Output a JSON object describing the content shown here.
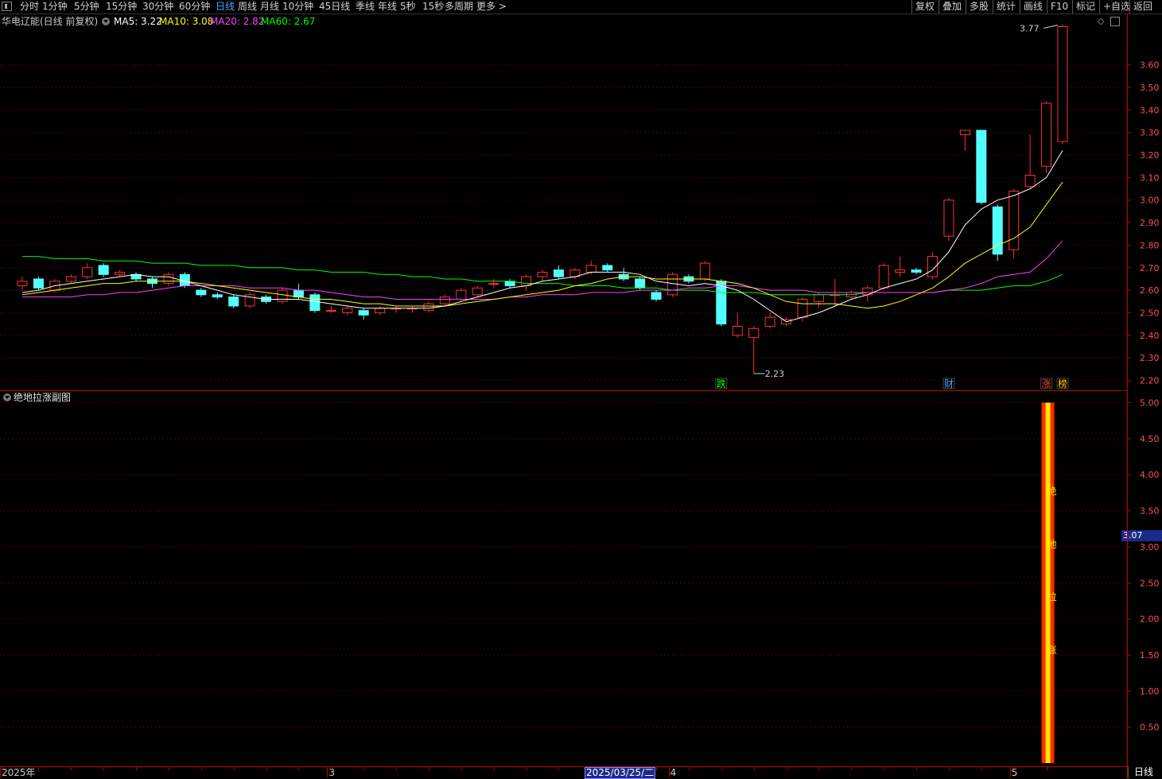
{
  "toolbar": {
    "periods": [
      "分时",
      "1分钟",
      "5分钟",
      "15分钟",
      "30分钟",
      "60分钟",
      "日线",
      "周线",
      "月线",
      "10分钟",
      "45日线",
      "季线",
      "年线",
      "5秒",
      "15秒",
      "多周期",
      "更多 >"
    ],
    "active_period": "日线",
    "right_buttons": [
      "复权",
      "叠加",
      "多股",
      "统计",
      "画线",
      "F10",
      "标记",
      "+自选",
      "返回"
    ]
  },
  "stock": {
    "title": "华电辽能(日线 前复权)",
    "ma_labels": [
      {
        "text": "MA5: 3.22",
        "color": "#ffffff"
      },
      {
        "text": "MA10: 3.08",
        "color": "#ffff00"
      },
      {
        "text": "MA20: 2.82",
        "color": "#ff40ff"
      },
      {
        "text": "MA60: 2.67",
        "color": "#00ff00"
      }
    ]
  },
  "colors": {
    "up": "#ff3030",
    "down": "#54ffff",
    "grid": "#8b0000",
    "axis": "#c00000",
    "ma5": "#ffffff",
    "ma10": "#ffff00",
    "ma20": "#ff40ff",
    "ma60": "#00ff00"
  },
  "chart_data": [
    {
      "type": "candlestick",
      "title": "华电辽能(日线 前复权)",
      "ylim": [
        2.17,
        3.8
      ],
      "y_ticks": [
        "3.60",
        "3.50",
        "3.40",
        "3.30",
        "3.20",
        "3.10",
        "3.00",
        "2.90",
        "2.80",
        "2.70",
        "2.60",
        "2.50",
        "2.40",
        "2.30",
        "2.20"
      ],
      "annotations": {
        "high": "3.77",
        "low": "2.23"
      },
      "markers": [
        {
          "text": "跌",
          "index": 43,
          "color": "#00ff00"
        },
        {
          "text": "财",
          "index": 57,
          "color": "#4aa3ff"
        },
        {
          "text": "涨",
          "index": 63,
          "color": "#ff4040"
        },
        {
          "text": "榜",
          "index": 64,
          "color": "#ffcc00"
        }
      ],
      "candles": [
        [
          2.62,
          2.64,
          2.66,
          2.6
        ],
        [
          2.65,
          2.61,
          2.66,
          2.6
        ],
        [
          2.6,
          2.64,
          2.65,
          2.59
        ],
        [
          2.64,
          2.66,
          2.67,
          2.63
        ],
        [
          2.66,
          2.7,
          2.72,
          2.65
        ],
        [
          2.71,
          2.67,
          2.72,
          2.66
        ],
        [
          2.67,
          2.68,
          2.69,
          2.66
        ],
        [
          2.67,
          2.65,
          2.68,
          2.64
        ],
        [
          2.65,
          2.63,
          2.66,
          2.61
        ],
        [
          2.63,
          2.67,
          2.68,
          2.62
        ],
        [
          2.67,
          2.62,
          2.68,
          2.61
        ],
        [
          2.6,
          2.58,
          2.61,
          2.57
        ],
        [
          2.58,
          2.57,
          2.59,
          2.56
        ],
        [
          2.57,
          2.53,
          2.58,
          2.52
        ],
        [
          2.53,
          2.58,
          2.59,
          2.52
        ],
        [
          2.57,
          2.55,
          2.58,
          2.54
        ],
        [
          2.55,
          2.6,
          2.61,
          2.54
        ],
        [
          2.6,
          2.57,
          2.63,
          2.56
        ],
        [
          2.58,
          2.51,
          2.59,
          2.5
        ],
        [
          2.51,
          2.51,
          2.53,
          2.5
        ],
        [
          2.5,
          2.52,
          2.53,
          2.49
        ],
        [
          2.51,
          2.49,
          2.52,
          2.47
        ],
        [
          2.5,
          2.52,
          2.53,
          2.49
        ],
        [
          2.52,
          2.52,
          2.53,
          2.5
        ],
        [
          2.52,
          2.52,
          2.53,
          2.5
        ],
        [
          2.51,
          2.54,
          2.55,
          2.5
        ],
        [
          2.54,
          2.57,
          2.58,
          2.53
        ],
        [
          2.56,
          2.6,
          2.61,
          2.55
        ],
        [
          2.58,
          2.61,
          2.62,
          2.57
        ],
        [
          2.63,
          2.63,
          2.65,
          2.61
        ],
        [
          2.64,
          2.62,
          2.65,
          2.61
        ],
        [
          2.62,
          2.66,
          2.67,
          2.6
        ],
        [
          2.66,
          2.68,
          2.69,
          2.64
        ],
        [
          2.69,
          2.66,
          2.71,
          2.65
        ],
        [
          2.66,
          2.69,
          2.7,
          2.65
        ],
        [
          2.68,
          2.71,
          2.73,
          2.67
        ],
        [
          2.71,
          2.69,
          2.72,
          2.68
        ],
        [
          2.67,
          2.65,
          2.7,
          2.64
        ],
        [
          2.65,
          2.61,
          2.66,
          2.6
        ],
        [
          2.59,
          2.56,
          2.6,
          2.55
        ],
        [
          2.58,
          2.67,
          2.68,
          2.57
        ],
        [
          2.66,
          2.64,
          2.67,
          2.63
        ],
        [
          2.65,
          2.72,
          2.73,
          2.64
        ],
        [
          2.64,
          2.45,
          2.65,
          2.44
        ],
        [
          2.4,
          2.44,
          2.5,
          2.39
        ],
        [
          2.39,
          2.43,
          2.44,
          2.23
        ],
        [
          2.44,
          2.48,
          2.5,
          2.43
        ],
        [
          2.45,
          2.47,
          2.48,
          2.44
        ],
        [
          2.48,
          2.56,
          2.57,
          2.46
        ],
        [
          2.55,
          2.58,
          2.59,
          2.52
        ],
        [
          2.58,
          2.58,
          2.65,
          2.53
        ],
        [
          2.57,
          2.59,
          2.6,
          2.56
        ],
        [
          2.58,
          2.61,
          2.62,
          2.55
        ],
        [
          2.61,
          2.71,
          2.72,
          2.6
        ],
        [
          2.68,
          2.69,
          2.75,
          2.66
        ],
        [
          2.69,
          2.68,
          2.7,
          2.67
        ],
        [
          2.66,
          2.75,
          2.77,
          2.65
        ],
        [
          2.84,
          3.0,
          3.01,
          2.82
        ],
        [
          3.29,
          3.31,
          3.31,
          3.22
        ],
        [
          3.31,
          2.99,
          3.31,
          2.98
        ],
        [
          2.97,
          2.76,
          2.98,
          2.73
        ],
        [
          2.78,
          3.04,
          3.05,
          2.74
        ],
        [
          3.06,
          3.11,
          3.29,
          3.05
        ],
        [
          3.15,
          3.43,
          3.44,
          3.12
        ],
        [
          3.26,
          3.77,
          3.78,
          3.25
        ]
      ],
      "ma5": [
        2.59,
        2.6,
        2.62,
        2.63,
        2.64,
        2.65,
        2.66,
        2.67,
        2.66,
        2.66,
        2.64,
        2.62,
        2.6,
        2.58,
        2.57,
        2.56,
        2.56,
        2.56,
        2.55,
        2.54,
        2.53,
        2.52,
        2.52,
        2.52,
        2.52,
        2.52,
        2.53,
        2.55,
        2.57,
        2.59,
        2.61,
        2.62,
        2.64,
        2.65,
        2.66,
        2.68,
        2.68,
        2.68,
        2.67,
        2.64,
        2.63,
        2.62,
        2.63,
        2.62,
        2.6,
        2.56,
        2.51,
        2.46,
        2.48,
        2.5,
        2.53,
        2.56,
        2.58,
        2.61,
        2.63,
        2.65,
        2.69,
        2.77,
        2.89,
        2.96,
        3.0,
        3.02,
        3.05,
        3.1,
        3.22
      ],
      "ma10": [
        2.58,
        2.59,
        2.6,
        2.61,
        2.62,
        2.63,
        2.63,
        2.64,
        2.64,
        2.64,
        2.64,
        2.63,
        2.62,
        2.61,
        2.6,
        2.59,
        2.58,
        2.57,
        2.56,
        2.56,
        2.55,
        2.54,
        2.54,
        2.53,
        2.53,
        2.53,
        2.53,
        2.54,
        2.55,
        2.56,
        2.57,
        2.58,
        2.59,
        2.6,
        2.62,
        2.63,
        2.65,
        2.66,
        2.66,
        2.65,
        2.65,
        2.65,
        2.65,
        2.64,
        2.63,
        2.61,
        2.58,
        2.55,
        2.54,
        2.54,
        2.54,
        2.53,
        2.52,
        2.53,
        2.55,
        2.58,
        2.61,
        2.66,
        2.72,
        2.76,
        2.8,
        2.83,
        2.88,
        2.98,
        3.08
      ],
      "ma20": [
        2.57,
        2.57,
        2.57,
        2.57,
        2.58,
        2.58,
        2.59,
        2.59,
        2.6,
        2.61,
        2.62,
        2.62,
        2.62,
        2.62,
        2.61,
        2.61,
        2.61,
        2.6,
        2.6,
        2.59,
        2.58,
        2.57,
        2.57,
        2.56,
        2.56,
        2.56,
        2.56,
        2.56,
        2.56,
        2.56,
        2.57,
        2.57,
        2.58,
        2.58,
        2.58,
        2.59,
        2.59,
        2.59,
        2.6,
        2.6,
        2.6,
        2.61,
        2.61,
        2.62,
        2.62,
        2.61,
        2.6,
        2.6,
        2.6,
        2.59,
        2.59,
        2.59,
        2.59,
        2.59,
        2.59,
        2.59,
        2.59,
        2.6,
        2.61,
        2.63,
        2.66,
        2.67,
        2.68,
        2.74,
        2.82
      ],
      "ma60": [
        2.75,
        2.75,
        2.74,
        2.74,
        2.74,
        2.73,
        2.73,
        2.73,
        2.72,
        2.72,
        2.72,
        2.71,
        2.71,
        2.71,
        2.7,
        2.7,
        2.7,
        2.69,
        2.69,
        2.68,
        2.68,
        2.68,
        2.67,
        2.67,
        2.66,
        2.66,
        2.65,
        2.65,
        2.64,
        2.64,
        2.64,
        2.63,
        2.63,
        2.63,
        2.62,
        2.62,
        2.62,
        2.61,
        2.61,
        2.61,
        2.6,
        2.6,
        2.6,
        2.59,
        2.59,
        2.59,
        2.58,
        2.58,
        2.58,
        2.58,
        2.58,
        2.58,
        2.59,
        2.59,
        2.59,
        2.59,
        2.59,
        2.6,
        2.6,
        2.6,
        2.61,
        2.62,
        2.62,
        2.64,
        2.67
      ]
    },
    {
      "type": "bar",
      "title": "绝地拉涨副图",
      "ylim": [
        0,
        5.05
      ],
      "y_ticks": [
        "5.00",
        "4.50",
        "4.00",
        "3.50",
        "3.00",
        "2.50",
        "2.00",
        "1.50",
        "1.00",
        "0.50"
      ],
      "current_value": "3.07",
      "signal": {
        "index": 63,
        "value": 5.0,
        "label_chars": [
          "绝",
          "地",
          "拉",
          "涨"
        ]
      }
    }
  ],
  "date_axis": {
    "labels": [
      {
        "text": "2025年",
        "index": 0
      },
      {
        "text": "3",
        "index": 19
      },
      {
        "text": "4",
        "index": 40
      },
      {
        "text": "5",
        "index": 61
      }
    ],
    "selected": "2025/03/25/二",
    "period": "日线"
  }
}
